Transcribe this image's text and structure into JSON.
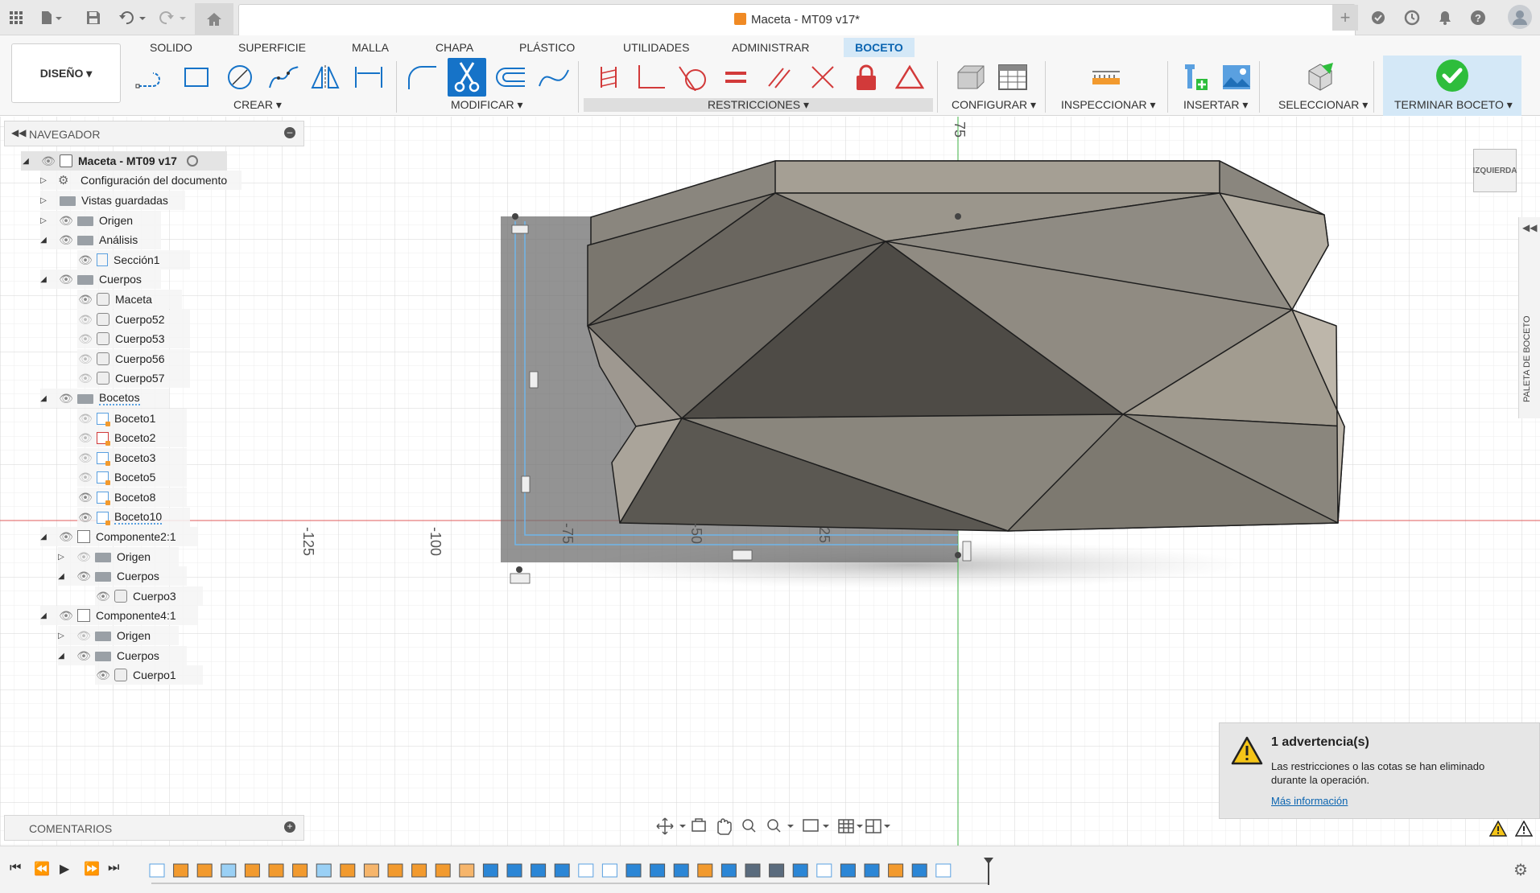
{
  "window": {
    "title": "Maceta - MT09 v17*"
  },
  "ribbon": {
    "workspace": "DISEÑO",
    "tabs": [
      "SOLIDO",
      "SUPERFICIE",
      "MALLA",
      "CHAPA",
      "PLÁSTICO",
      "UTILIDADES",
      "ADMINISTRAR",
      "BOCETO"
    ],
    "active_tab": "BOCETO",
    "groups": {
      "crear": "CREAR",
      "modificar": "MODIFICAR",
      "restricciones": "RESTRICCIONES",
      "configurar": "CONFIGURAR",
      "inspeccionar": "INSPECCIONAR",
      "insertar": "INSERTAR",
      "seleccionar": "SELECCIONAR",
      "terminar": "TERMINAR BOCETO"
    }
  },
  "browser": {
    "header": "NAVEGADOR",
    "root": "Maceta - MT09 v17",
    "items": [
      {
        "label": "Configuración del documento"
      },
      {
        "label": "Vistas guardadas"
      },
      {
        "label": "Origen"
      },
      {
        "label": "Análisis"
      },
      {
        "label": "Sección1"
      },
      {
        "label": "Cuerpos"
      },
      {
        "label": "Maceta"
      },
      {
        "label": "Cuerpo52"
      },
      {
        "label": "Cuerpo53"
      },
      {
        "label": "Cuerpo56"
      },
      {
        "label": "Cuerpo57"
      },
      {
        "label": "Bocetos"
      },
      {
        "label": "Boceto1"
      },
      {
        "label": "Boceto2"
      },
      {
        "label": "Boceto3"
      },
      {
        "label": "Boceto5"
      },
      {
        "label": "Boceto8"
      },
      {
        "label": "Boceto10"
      },
      {
        "label": "Componente2:1"
      },
      {
        "label": "Origen"
      },
      {
        "label": "Cuerpos"
      },
      {
        "label": "Cuerpo3"
      },
      {
        "label": "Componente4:1"
      },
      {
        "label": "Origen"
      },
      {
        "label": "Cuerpos"
      },
      {
        "label": "Cuerpo1"
      }
    ],
    "comments": "COMENTARIOS"
  },
  "viewport": {
    "axis_labels": {
      "y75": "75",
      "xm125": "-125",
      "xm100": "-100",
      "xm75": "-75",
      "xm50": "-50",
      "xm25": "25"
    },
    "viewcube": "IZQUIERDA",
    "palette": "PALETA DE BOCETO"
  },
  "warning": {
    "title": "1 advertencia(s)",
    "message": "Las restricciones o las cotas se han eliminado durante la operación.",
    "link": "Más información"
  },
  "colors": {
    "accent": "#1673c8",
    "finish_bg": "#d4e8f7",
    "check_green": "#2ebd3c",
    "axis_red": "#e05b5b",
    "axis_green": "#3cb043",
    "sketch_blue": "#6fb6ea"
  }
}
